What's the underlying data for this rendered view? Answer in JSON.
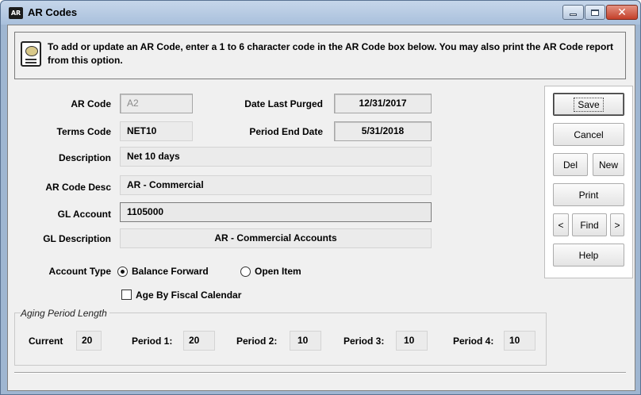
{
  "window": {
    "title": "AR Codes",
    "app_icon_text": "AR"
  },
  "info": {
    "text": "To add or update an AR Code, enter a 1 to 6 character code in the AR Code box below.  You may also print the AR Code report from this option."
  },
  "form": {
    "ar_code": {
      "label": "AR Code",
      "value": "A2"
    },
    "date_last_purged": {
      "label": "Date Last Purged",
      "value": "12/31/2017"
    },
    "terms_code": {
      "label": "Terms Code",
      "value": "NET10"
    },
    "period_end_date": {
      "label": "Period End Date",
      "value": "5/31/2018"
    },
    "description": {
      "label": "Description",
      "value": "Net 10 days"
    },
    "ar_code_desc": {
      "label": "AR Code Desc",
      "value": "AR - Commercial"
    },
    "gl_account": {
      "label": "GL Account",
      "value": "1105000"
    },
    "gl_description": {
      "label": "GL Description",
      "value": "AR - Commercial Accounts"
    },
    "account_type": {
      "label": "Account Type",
      "options": [
        "Balance Forward",
        "Open Item"
      ],
      "selected": "Balance Forward"
    },
    "age_by_fiscal": {
      "label": "Age By Fiscal Calendar",
      "checked": false
    }
  },
  "aging": {
    "title": "Aging Period Length",
    "current": {
      "label": "Current",
      "value": "20"
    },
    "period1": {
      "label": "Period 1:",
      "value": "20"
    },
    "period2": {
      "label": "Period 2:",
      "value": "10"
    },
    "period3": {
      "label": "Period 3:",
      "value": "10"
    },
    "period4": {
      "label": "Period 4:",
      "value": "10"
    }
  },
  "buttons": {
    "save": "Save",
    "cancel": "Cancel",
    "del": "Del",
    "new": "New",
    "print": "Print",
    "prev": "<",
    "find": "Find",
    "next": ">",
    "help": "Help"
  }
}
